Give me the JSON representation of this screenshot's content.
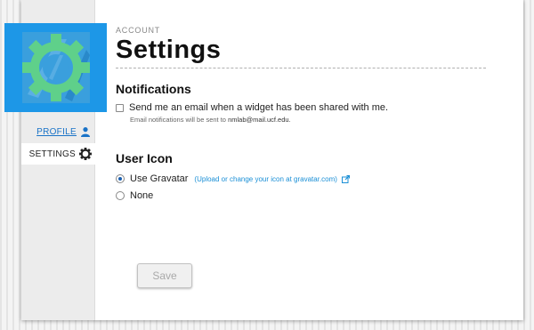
{
  "sidebar": {
    "items": [
      {
        "label": "PROFILE",
        "icon": "user-icon",
        "active": false
      },
      {
        "label": "SETTINGS",
        "icon": "gear-icon",
        "active": true
      }
    ]
  },
  "header": {
    "kicker": "ACCOUNT",
    "title": "Settings"
  },
  "notifications": {
    "heading": "Notifications",
    "checkbox_label": "Send me an email when a widget has been shared with me.",
    "checked": false,
    "note_prefix": "Email notifications will be sent to",
    "email": "nmlab@mail.ucf.edu."
  },
  "user_icon": {
    "heading": "User Icon",
    "options": [
      {
        "label": "Use Gravatar",
        "selected": true,
        "link": "(Upload or change your icon at gravatar.com)"
      },
      {
        "label": "None",
        "selected": false
      }
    ]
  },
  "actions": {
    "save_label": "Save",
    "save_enabled": false
  },
  "colors": {
    "accent": "#1d97e7",
    "link": "#1a73c7",
    "gear": "#5fd08a"
  }
}
